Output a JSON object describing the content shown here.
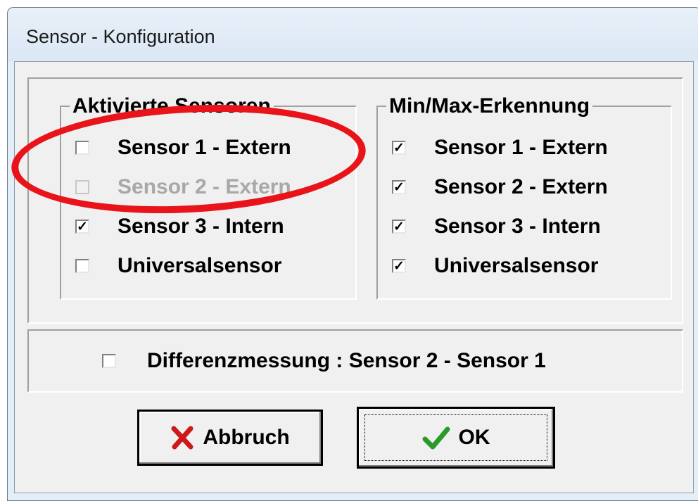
{
  "window": {
    "title": "Sensor - Konfiguration"
  },
  "activated_group": {
    "title": "Aktivierte Sensoren",
    "items": [
      {
        "label": "Sensor 1 - Extern",
        "checked": "",
        "enabled": true
      },
      {
        "label": "Sensor 2 - Extern",
        "checked": "",
        "enabled": false
      },
      {
        "label": "Sensor 3 - Intern",
        "checked": "✓",
        "enabled": true
      },
      {
        "label": "Universalsensor",
        "checked": "",
        "enabled": true
      }
    ]
  },
  "minmax_group": {
    "title": "Min/Max-Erkennung",
    "items": [
      {
        "label": "Sensor 1 - Extern",
        "checked": "✓"
      },
      {
        "label": "Sensor 2 - Extern",
        "checked": "✓"
      },
      {
        "label": "Sensor 3 - Intern",
        "checked": "✓"
      },
      {
        "label": "Universalsensor",
        "checked": "✓"
      }
    ]
  },
  "differential": {
    "label": "Differenzmessung :  Sensor 2 - Sensor 1",
    "checked": ""
  },
  "buttons": {
    "cancel_label": "Abbruch",
    "ok_label": "OK"
  },
  "colors": {
    "annotation": "#e8141a",
    "cancel_icon": "#cc1a1a",
    "ok_icon": "#2a9a2a"
  },
  "icons": {
    "cancel": "x-icon",
    "ok": "checkmark-icon"
  }
}
